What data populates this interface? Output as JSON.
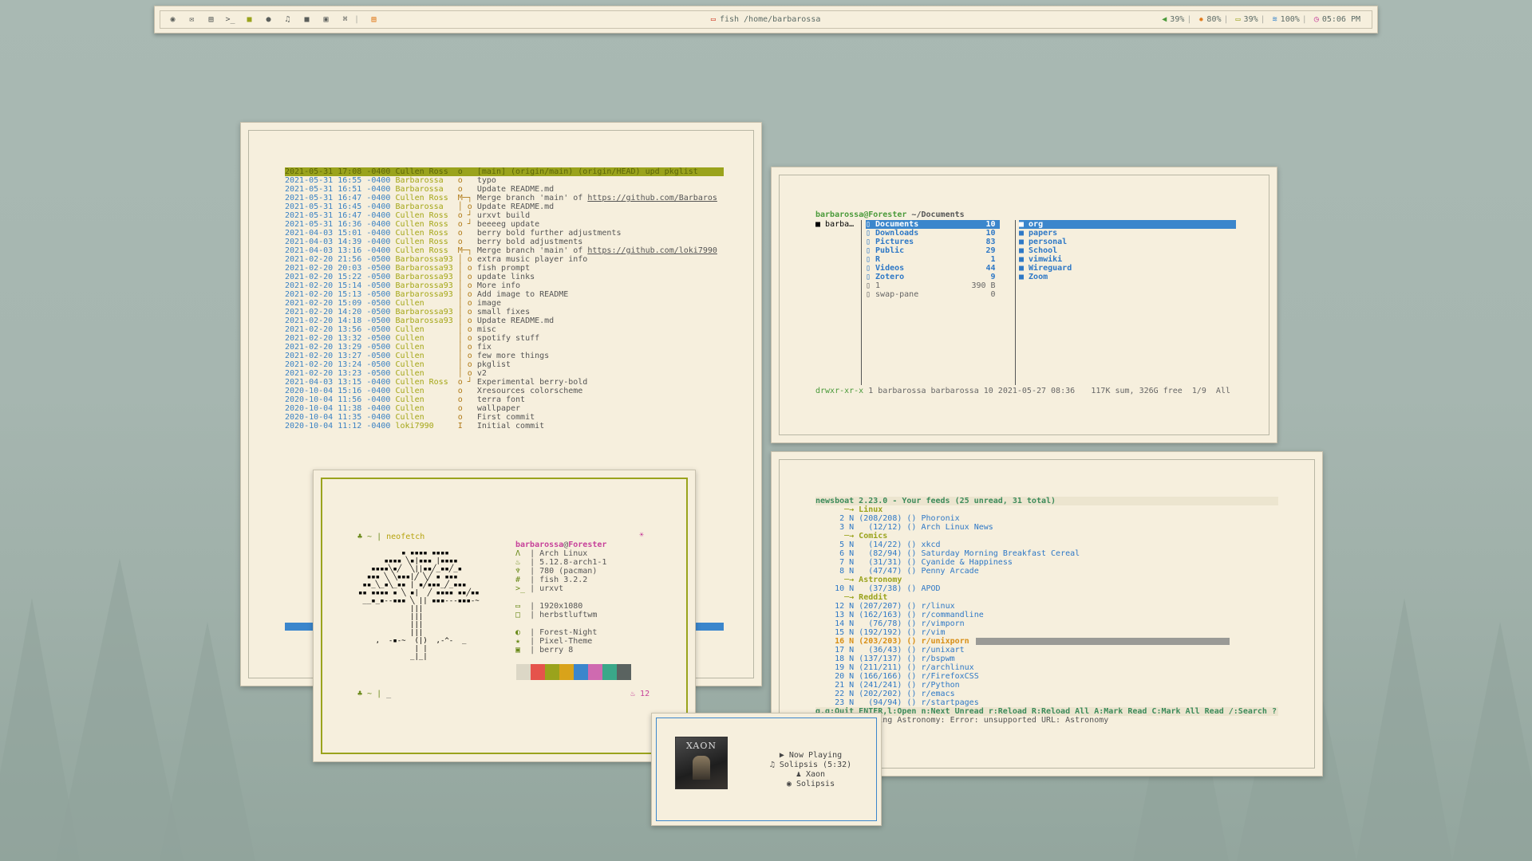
{
  "topbar": {
    "icons": [
      "launcher-icon",
      "mail-icon",
      "document-icon",
      "terminal-icon",
      "folder-icon",
      "chat-icon",
      "music-icon",
      "video-icon",
      "image-icon",
      "settings-icon",
      "calendar-icon"
    ],
    "terminal_icon_text": ">_",
    "title": "fish /home/barbarossa",
    "volume": "39%",
    "brightness": "80%",
    "battery": "39%",
    "wifi": "100%",
    "time": "05:06 PM"
  },
  "gitlog": {
    "rows": [
      {
        "date": "2021-05-31 17:08 -0400",
        "author": "Cullen Ross",
        "graph": "o",
        "msg": "[main] (origin/main) (origin/HEAD) upd pkglist"
      },
      {
        "date": "2021-05-31 16:55 -0400",
        "author": "Barbarossa",
        "graph": "o",
        "msg": "typo"
      },
      {
        "date": "2021-05-31 16:51 -0400",
        "author": "Barbarossa",
        "graph": "o",
        "msg": "Update README.md"
      },
      {
        "date": "2021-05-31 16:47 -0400",
        "author": "Cullen Ross",
        "graph": "M─┐",
        "msg": "Merge branch 'main' of ",
        "url": "https://github.com/Barbaros"
      },
      {
        "date": "2021-05-31 16:45 -0400",
        "author": "Barbarossa",
        "graph": "│ o",
        "msg": "Update README.md"
      },
      {
        "date": "2021-05-31 16:47 -0400",
        "author": "Cullen Ross",
        "graph": "o ┘",
        "msg": "urxvt build"
      },
      {
        "date": "2021-05-31 16:36 -0400",
        "author": "Cullen Ross",
        "graph": "o ┘",
        "msg": "beeeeg update"
      },
      {
        "date": "2021-04-03 15:01 -0400",
        "author": "Cullen Ross",
        "graph": "o",
        "msg": "berry bold further adjustments"
      },
      {
        "date": "2021-04-03 14:39 -0400",
        "author": "Cullen Ross",
        "graph": "o",
        "msg": "berry bold adjustments"
      },
      {
        "date": "2021-04-03 13:16 -0400",
        "author": "Cullen Ross",
        "graph": "M─┐",
        "msg": "Merge branch 'main' of ",
        "url": "https://github.com/loki7990"
      },
      {
        "date": "2021-02-20 21:56 -0500",
        "author": "Barbarossa93",
        "graph": "│ o",
        "msg": "extra music player info"
      },
      {
        "date": "2021-02-20 20:03 -0500",
        "author": "Barbarossa93",
        "graph": "│ o",
        "msg": "fish prompt"
      },
      {
        "date": "2021-02-20 15:22 -0500",
        "author": "Barbarossa93",
        "graph": "│ o",
        "msg": "update links"
      },
      {
        "date": "2021-02-20 15:14 -0500",
        "author": "Barbarossa93",
        "graph": "│ o",
        "msg": "More info"
      },
      {
        "date": "2021-02-20 15:13 -0500",
        "author": "Barbarossa93",
        "graph": "│ o",
        "msg": "Add image to README"
      },
      {
        "date": "2021-02-20 15:09 -0500",
        "author": "Cullen",
        "graph": "│ o",
        "msg": "image"
      },
      {
        "date": "2021-02-20 14:20 -0500",
        "author": "Barbarossa93",
        "graph": "│ o",
        "msg": "small fixes"
      },
      {
        "date": "2021-02-20 14:18 -0500",
        "author": "Barbarossa93",
        "graph": "│ o",
        "msg": "Update README.md"
      },
      {
        "date": "2021-02-20 13:56 -0500",
        "author": "Cullen",
        "graph": "│ o",
        "msg": "misc"
      },
      {
        "date": "2021-02-20 13:32 -0500",
        "author": "Cullen",
        "graph": "│ o",
        "msg": "spotify stuff"
      },
      {
        "date": "2021-02-20 13:29 -0500",
        "author": "Cullen",
        "graph": "│ o",
        "msg": "fix"
      },
      {
        "date": "2021-02-20 13:27 -0500",
        "author": "Cullen",
        "graph": "│ o",
        "msg": "few more things"
      },
      {
        "date": "2021-02-20 13:24 -0500",
        "author": "Cullen",
        "graph": "│ o",
        "msg": "pkglist"
      },
      {
        "date": "2021-02-20 13:23 -0500",
        "author": "Cullen",
        "graph": "│ o",
        "msg": "v2"
      },
      {
        "date": "2021-04-03 13:15 -0400",
        "author": "Cullen Ross",
        "graph": "o ┘",
        "msg": "Experimental berry-bold"
      },
      {
        "date": "2020-10-04 15:16 -0400",
        "author": "Cullen",
        "graph": "o",
        "msg": "Xresources colorscheme"
      },
      {
        "date": "2020-10-04 11:56 -0400",
        "author": "Cullen",
        "graph": "o",
        "msg": "terra font"
      },
      {
        "date": "2020-10-04 11:38 -0400",
        "author": "Cullen",
        "graph": "o",
        "msg": "wallpaper"
      },
      {
        "date": "2020-10-04 11:35 -0400",
        "author": "Cullen",
        "graph": "o",
        "msg": "First commit"
      },
      {
        "date": "2020-10-04 11:12 -0400",
        "author": "loki7990",
        "graph": "I",
        "msg": "Initial commit"
      }
    ]
  },
  "ranger": {
    "header_user": "barbarossa@Forester",
    "header_path": "~/Documents",
    "parent_col": "barba…",
    "files": [
      {
        "icon": "▯",
        "name": "Documents",
        "count": "10"
      },
      {
        "icon": "▯",
        "name": "Downloads",
        "count": "10"
      },
      {
        "icon": "▯",
        "name": "Pictures",
        "count": "83"
      },
      {
        "icon": "▯",
        "name": "Public",
        "count": "29"
      },
      {
        "icon": "▯",
        "name": "R",
        "count": "1"
      },
      {
        "icon": "▯",
        "name": "Videos",
        "count": "44"
      },
      {
        "icon": "▯",
        "name": "Zotero",
        "count": "9"
      },
      {
        "icon": "▯",
        "name": "1",
        "count": "390 B"
      },
      {
        "icon": "▯",
        "name": "swap-pane",
        "count": "0"
      }
    ],
    "preview": [
      "org",
      "papers",
      "personal",
      "School",
      "vimwiki",
      "Wireguard",
      "Zoom"
    ],
    "status_perm": "drwxr-xr-x",
    "status_rest": "1 barbarossa barbarossa 10 2021-05-27 08:36",
    "status_right": "117K sum, 326G free  1/9  All"
  },
  "newsboat": {
    "title": "newsboat 2.23.0 - Your feeds (25 unread, 31 total)",
    "groups": [
      {
        "cat": "Linux",
        "feeds": [
          {
            "n": "2",
            "c": "(208/208)",
            "name": "Phoronix"
          },
          {
            "n": "3",
            "c": "(12/12)",
            "name": "Arch Linux News"
          }
        ]
      },
      {
        "cat": "Comics",
        "feeds": [
          {
            "n": "5",
            "c": "(14/22)",
            "name": "xkcd"
          },
          {
            "n": "6",
            "c": "(82/94)",
            "name": "Saturday Morning Breakfast Cereal"
          },
          {
            "n": "7",
            "c": "(31/31)",
            "name": "Cyanide & Happiness"
          },
          {
            "n": "8",
            "c": "(47/47)",
            "name": "Penny Arcade"
          }
        ]
      },
      {
        "cat": "Astronomy",
        "feeds": [
          {
            "n": "10",
            "c": "(37/38)",
            "name": "APOD"
          }
        ]
      },
      {
        "cat": "Reddit",
        "feeds": [
          {
            "n": "12",
            "c": "(207/207)",
            "name": "r/linux"
          },
          {
            "n": "13",
            "c": "(162/163)",
            "name": "r/commandline"
          },
          {
            "n": "14",
            "c": "(76/78)",
            "name": "r/vimporn"
          },
          {
            "n": "15",
            "c": "(192/192)",
            "name": "r/vim"
          },
          {
            "n": "16",
            "c": "(203/203)",
            "name": "r/unixporn"
          },
          {
            "n": "17",
            "c": "(36/43)",
            "name": "r/unixart"
          },
          {
            "n": "18",
            "c": "(137/137)",
            "name": "r/bspwm"
          },
          {
            "n": "19",
            "c": "(211/211)",
            "name": "r/archlinux"
          },
          {
            "n": "20",
            "c": "(166/166)",
            "name": "r/FirefoxCSS"
          },
          {
            "n": "21",
            "c": "(241/241)",
            "name": "r/Python"
          },
          {
            "n": "22",
            "c": "(202/202)",
            "name": "r/emacs"
          },
          {
            "n": "23",
            "c": "(94/94)",
            "name": "r/startpages"
          }
        ]
      }
    ],
    "footer": "q,q:Quit ENTER,l:Open n:Next Unread r:Reload R:Reload All A:Mark Read C:Mark All Read /:Search ?",
    "error": "Error retrieving Astronomy: Error: unsupported URL: Astronomy"
  },
  "neofetch": {
    "prompt_cmd": "neofetch",
    "user": "barbarossa",
    "host": "Forester",
    "info": [
      {
        "icon": "arch-icon",
        "glyph": "Λ",
        "text": "Arch Linux"
      },
      {
        "icon": "kernel-icon",
        "glyph": "♨",
        "text": "5.12.8-arch1-1"
      },
      {
        "icon": "packages-icon",
        "glyph": "♆",
        "text": "780 (pacman)"
      },
      {
        "icon": "shell-icon",
        "glyph": "#",
        "text": "fish 3.2.2"
      },
      {
        "icon": "terminal-icon",
        "glyph": ">_",
        "text": "urxvt"
      }
    ],
    "info2": [
      {
        "icon": "display-icon",
        "glyph": "▭",
        "text": "1920x1080"
      },
      {
        "icon": "wm-icon",
        "glyph": "□",
        "text": "herbstluftwm"
      }
    ],
    "info3": [
      {
        "icon": "theme-icon",
        "glyph": "◐",
        "text": "Forest-Night"
      },
      {
        "icon": "icons-icon",
        "glyph": "★",
        "text": "Pixel-Theme"
      },
      {
        "icon": "font-icon",
        "glyph": "▣",
        "text": "berry 8"
      }
    ],
    "palette": [
      "#dcd7c6",
      "#e5534b",
      "#9aa31c",
      "#d9a31a",
      "#3b86cc",
      "#cf6ab0",
      "#3aa889",
      "#5a6360"
    ],
    "right_counter": "12"
  },
  "player": {
    "cover_text": "XAON",
    "now_playing": "Now Playing",
    "track": "Solipsis (5:32)",
    "artist": "Xaon",
    "album": "Solipsis"
  }
}
